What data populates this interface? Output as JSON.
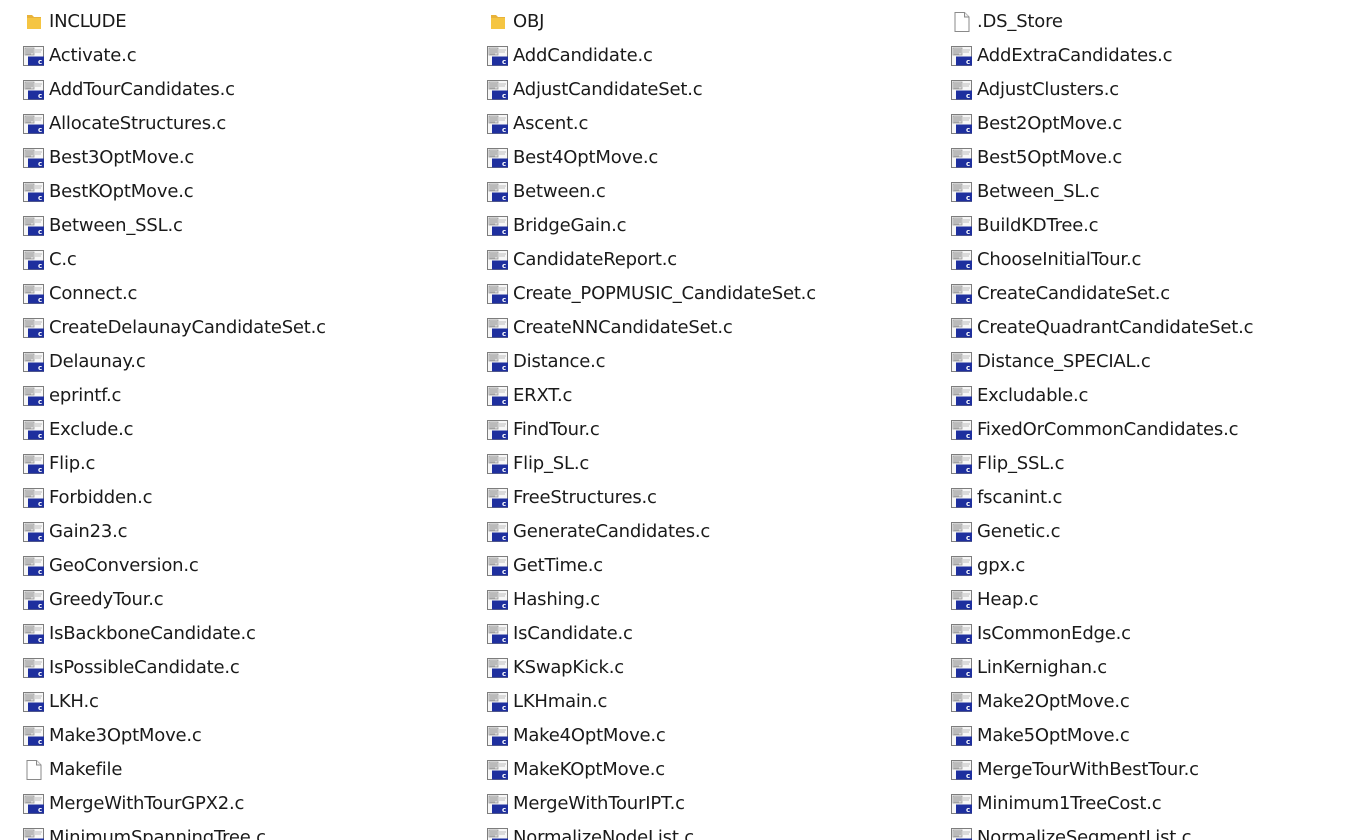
{
  "columns": [
    {
      "items": [
        {
          "name": "INCLUDE",
          "type": "folder"
        },
        {
          "name": "Activate.c",
          "type": "c"
        },
        {
          "name": "AddTourCandidates.c",
          "type": "c"
        },
        {
          "name": "AllocateStructures.c",
          "type": "c"
        },
        {
          "name": "Best3OptMove.c",
          "type": "c"
        },
        {
          "name": "BestKOptMove.c",
          "type": "c"
        },
        {
          "name": "Between_SSL.c",
          "type": "c"
        },
        {
          "name": "C.c",
          "type": "c"
        },
        {
          "name": "Connect.c",
          "type": "c"
        },
        {
          "name": "CreateDelaunayCandidateSet.c",
          "type": "c"
        },
        {
          "name": "Delaunay.c",
          "type": "c"
        },
        {
          "name": "eprintf.c",
          "type": "c"
        },
        {
          "name": "Exclude.c",
          "type": "c"
        },
        {
          "name": "Flip.c",
          "type": "c"
        },
        {
          "name": "Forbidden.c",
          "type": "c"
        },
        {
          "name": "Gain23.c",
          "type": "c"
        },
        {
          "name": "GeoConversion.c",
          "type": "c"
        },
        {
          "name": "GreedyTour.c",
          "type": "c"
        },
        {
          "name": "IsBackboneCandidate.c",
          "type": "c"
        },
        {
          "name": "IsPossibleCandidate.c",
          "type": "c"
        },
        {
          "name": "LKH.c",
          "type": "c"
        },
        {
          "name": "Make3OptMove.c",
          "type": "c"
        },
        {
          "name": "Makefile",
          "type": "file"
        },
        {
          "name": "MergeWithTourGPX2.c",
          "type": "c"
        },
        {
          "name": "MinimumSpanningTree.c",
          "type": "c"
        }
      ]
    },
    {
      "items": [
        {
          "name": "OBJ",
          "type": "folder"
        },
        {
          "name": "AddCandidate.c",
          "type": "c"
        },
        {
          "name": "AdjustCandidateSet.c",
          "type": "c"
        },
        {
          "name": "Ascent.c",
          "type": "c"
        },
        {
          "name": "Best4OptMove.c",
          "type": "c"
        },
        {
          "name": "Between.c",
          "type": "c"
        },
        {
          "name": "BridgeGain.c",
          "type": "c"
        },
        {
          "name": "CandidateReport.c",
          "type": "c"
        },
        {
          "name": "Create_POPMUSIC_CandidateSet.c",
          "type": "c"
        },
        {
          "name": "CreateNNCandidateSet.c",
          "type": "c"
        },
        {
          "name": "Distance.c",
          "type": "c"
        },
        {
          "name": "ERXT.c",
          "type": "c"
        },
        {
          "name": "FindTour.c",
          "type": "c"
        },
        {
          "name": "Flip_SL.c",
          "type": "c"
        },
        {
          "name": "FreeStructures.c",
          "type": "c"
        },
        {
          "name": "GenerateCandidates.c",
          "type": "c"
        },
        {
          "name": "GetTime.c",
          "type": "c"
        },
        {
          "name": "Hashing.c",
          "type": "c"
        },
        {
          "name": "IsCandidate.c",
          "type": "c"
        },
        {
          "name": "KSwapKick.c",
          "type": "c"
        },
        {
          "name": "LKHmain.c",
          "type": "c"
        },
        {
          "name": "Make4OptMove.c",
          "type": "c"
        },
        {
          "name": "MakeKOptMove.c",
          "type": "c"
        },
        {
          "name": "MergeWithTourIPT.c",
          "type": "c"
        },
        {
          "name": "NormalizeNodeList.c",
          "type": "c"
        }
      ]
    },
    {
      "items": [
        {
          "name": ".DS_Store",
          "type": "file"
        },
        {
          "name": "AddExtraCandidates.c",
          "type": "c"
        },
        {
          "name": "AdjustClusters.c",
          "type": "c"
        },
        {
          "name": "Best2OptMove.c",
          "type": "c"
        },
        {
          "name": "Best5OptMove.c",
          "type": "c"
        },
        {
          "name": "Between_SL.c",
          "type": "c"
        },
        {
          "name": "BuildKDTree.c",
          "type": "c"
        },
        {
          "name": "ChooseInitialTour.c",
          "type": "c"
        },
        {
          "name": "CreateCandidateSet.c",
          "type": "c"
        },
        {
          "name": "CreateQuadrantCandidateSet.c",
          "type": "c"
        },
        {
          "name": "Distance_SPECIAL.c",
          "type": "c"
        },
        {
          "name": "Excludable.c",
          "type": "c"
        },
        {
          "name": "FixedOrCommonCandidates.c",
          "type": "c"
        },
        {
          "name": "Flip_SSL.c",
          "type": "c"
        },
        {
          "name": "fscanint.c",
          "type": "c"
        },
        {
          "name": "Genetic.c",
          "type": "c"
        },
        {
          "name": "gpx.c",
          "type": "c"
        },
        {
          "name": "Heap.c",
          "type": "c"
        },
        {
          "name": "IsCommonEdge.c",
          "type": "c"
        },
        {
          "name": "LinKernighan.c",
          "type": "c"
        },
        {
          "name": "Make2OptMove.c",
          "type": "c"
        },
        {
          "name": "Make5OptMove.c",
          "type": "c"
        },
        {
          "name": "MergeTourWithBestTour.c",
          "type": "c"
        },
        {
          "name": "Minimum1TreeCost.c",
          "type": "c"
        },
        {
          "name": "NormalizeSegmentList.c",
          "type": "c"
        }
      ]
    }
  ],
  "icon_names": {
    "folder": "folder-icon",
    "c": "c-source-file-icon",
    "file": "blank-file-icon"
  },
  "colors": {
    "folder": "#f5c542",
    "c_badge": "#1e2f9e",
    "text": "#1a1a1a",
    "background": "#ffffff"
  }
}
